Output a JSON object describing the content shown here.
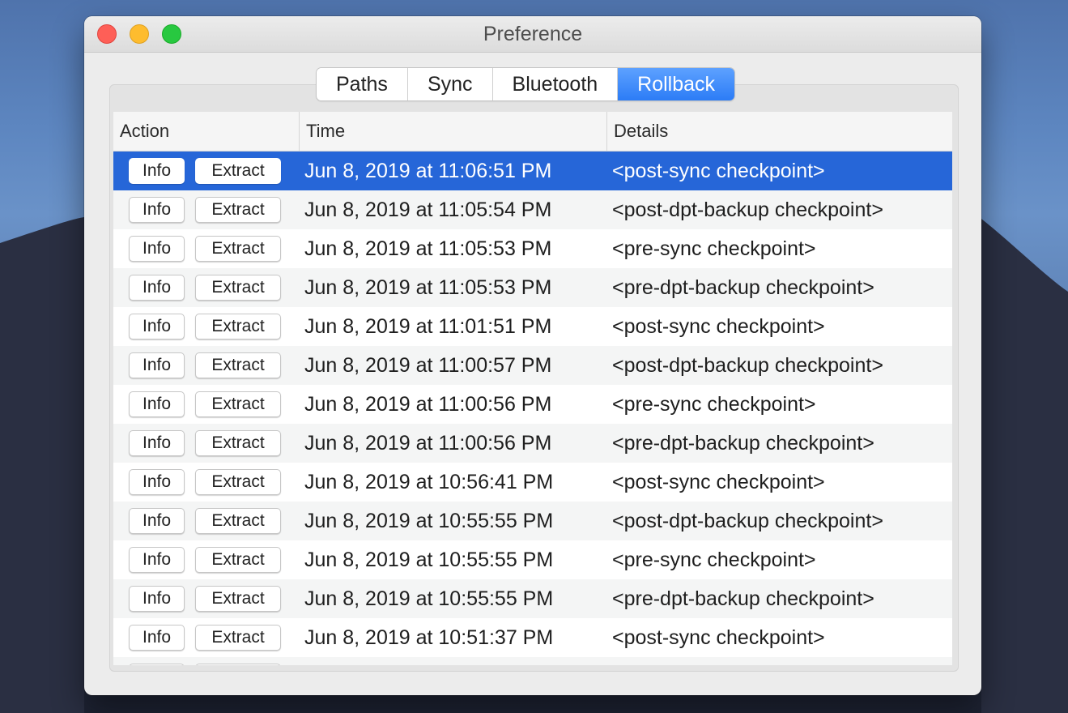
{
  "window": {
    "title": "Preference"
  },
  "tabs": [
    {
      "label": "Paths",
      "selected": false
    },
    {
      "label": "Sync",
      "selected": false
    },
    {
      "label": "Bluetooth",
      "selected": false
    },
    {
      "label": "Rollback",
      "selected": true
    }
  ],
  "table": {
    "columns": [
      "Action",
      "Time",
      "Details"
    ],
    "info_label": "Info",
    "extract_label": "Extract",
    "rows": [
      {
        "time": "Jun 8, 2019 at 11:06:51 PM",
        "details": "<post-sync checkpoint>",
        "selected": true
      },
      {
        "time": "Jun 8, 2019 at 11:05:54 PM",
        "details": "<post-dpt-backup checkpoint>"
      },
      {
        "time": "Jun 8, 2019 at 11:05:53 PM",
        "details": "<pre-sync checkpoint>"
      },
      {
        "time": "Jun 8, 2019 at 11:05:53 PM",
        "details": "<pre-dpt-backup checkpoint>"
      },
      {
        "time": "Jun 8, 2019 at 11:01:51 PM",
        "details": "<post-sync checkpoint>"
      },
      {
        "time": "Jun 8, 2019 at 11:00:57 PM",
        "details": "<post-dpt-backup checkpoint>"
      },
      {
        "time": "Jun 8, 2019 at 11:00:56 PM",
        "details": "<pre-sync checkpoint>"
      },
      {
        "time": "Jun 8, 2019 at 11:00:56 PM",
        "details": "<pre-dpt-backup checkpoint>"
      },
      {
        "time": "Jun 8, 2019 at 10:56:41 PM",
        "details": "<post-sync checkpoint>"
      },
      {
        "time": "Jun 8, 2019 at 10:55:55 PM",
        "details": "<post-dpt-backup checkpoint>"
      },
      {
        "time": "Jun 8, 2019 at 10:55:55 PM",
        "details": "<pre-sync checkpoint>"
      },
      {
        "time": "Jun 8, 2019 at 10:55:55 PM",
        "details": "<pre-dpt-backup checkpoint>"
      },
      {
        "time": "Jun 8, 2019 at 10:51:37 PM",
        "details": "<post-sync checkpoint>"
      }
    ]
  },
  "colors": {
    "selection": "#2666d8",
    "tab_selected": "#2c7cf6",
    "close": "#fe5f57",
    "minimize": "#febc2e",
    "maximize": "#28c840"
  }
}
